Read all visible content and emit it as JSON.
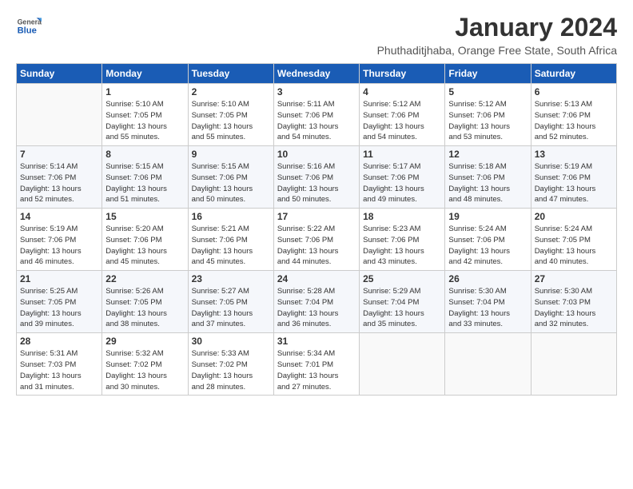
{
  "logo": {
    "general": "General",
    "blue": "Blue"
  },
  "title": "January 2024",
  "subtitle": "Phuthaditjhaba, Orange Free State, South Africa",
  "headers": [
    "Sunday",
    "Monday",
    "Tuesday",
    "Wednesday",
    "Thursday",
    "Friday",
    "Saturday"
  ],
  "weeks": [
    [
      {
        "num": "",
        "lines": []
      },
      {
        "num": "1",
        "lines": [
          "Sunrise: 5:10 AM",
          "Sunset: 7:05 PM",
          "Daylight: 13 hours",
          "and 55 minutes."
        ]
      },
      {
        "num": "2",
        "lines": [
          "Sunrise: 5:10 AM",
          "Sunset: 7:05 PM",
          "Daylight: 13 hours",
          "and 55 minutes."
        ]
      },
      {
        "num": "3",
        "lines": [
          "Sunrise: 5:11 AM",
          "Sunset: 7:06 PM",
          "Daylight: 13 hours",
          "and 54 minutes."
        ]
      },
      {
        "num": "4",
        "lines": [
          "Sunrise: 5:12 AM",
          "Sunset: 7:06 PM",
          "Daylight: 13 hours",
          "and 54 minutes."
        ]
      },
      {
        "num": "5",
        "lines": [
          "Sunrise: 5:12 AM",
          "Sunset: 7:06 PM",
          "Daylight: 13 hours",
          "and 53 minutes."
        ]
      },
      {
        "num": "6",
        "lines": [
          "Sunrise: 5:13 AM",
          "Sunset: 7:06 PM",
          "Daylight: 13 hours",
          "and 52 minutes."
        ]
      }
    ],
    [
      {
        "num": "7",
        "lines": [
          "Sunrise: 5:14 AM",
          "Sunset: 7:06 PM",
          "Daylight: 13 hours",
          "and 52 minutes."
        ]
      },
      {
        "num": "8",
        "lines": [
          "Sunrise: 5:15 AM",
          "Sunset: 7:06 PM",
          "Daylight: 13 hours",
          "and 51 minutes."
        ]
      },
      {
        "num": "9",
        "lines": [
          "Sunrise: 5:15 AM",
          "Sunset: 7:06 PM",
          "Daylight: 13 hours",
          "and 50 minutes."
        ]
      },
      {
        "num": "10",
        "lines": [
          "Sunrise: 5:16 AM",
          "Sunset: 7:06 PM",
          "Daylight: 13 hours",
          "and 50 minutes."
        ]
      },
      {
        "num": "11",
        "lines": [
          "Sunrise: 5:17 AM",
          "Sunset: 7:06 PM",
          "Daylight: 13 hours",
          "and 49 minutes."
        ]
      },
      {
        "num": "12",
        "lines": [
          "Sunrise: 5:18 AM",
          "Sunset: 7:06 PM",
          "Daylight: 13 hours",
          "and 48 minutes."
        ]
      },
      {
        "num": "13",
        "lines": [
          "Sunrise: 5:19 AM",
          "Sunset: 7:06 PM",
          "Daylight: 13 hours",
          "and 47 minutes."
        ]
      }
    ],
    [
      {
        "num": "14",
        "lines": [
          "Sunrise: 5:19 AM",
          "Sunset: 7:06 PM",
          "Daylight: 13 hours",
          "and 46 minutes."
        ]
      },
      {
        "num": "15",
        "lines": [
          "Sunrise: 5:20 AM",
          "Sunset: 7:06 PM",
          "Daylight: 13 hours",
          "and 45 minutes."
        ]
      },
      {
        "num": "16",
        "lines": [
          "Sunrise: 5:21 AM",
          "Sunset: 7:06 PM",
          "Daylight: 13 hours",
          "and 45 minutes."
        ]
      },
      {
        "num": "17",
        "lines": [
          "Sunrise: 5:22 AM",
          "Sunset: 7:06 PM",
          "Daylight: 13 hours",
          "and 44 minutes."
        ]
      },
      {
        "num": "18",
        "lines": [
          "Sunrise: 5:23 AM",
          "Sunset: 7:06 PM",
          "Daylight: 13 hours",
          "and 43 minutes."
        ]
      },
      {
        "num": "19",
        "lines": [
          "Sunrise: 5:24 AM",
          "Sunset: 7:06 PM",
          "Daylight: 13 hours",
          "and 42 minutes."
        ]
      },
      {
        "num": "20",
        "lines": [
          "Sunrise: 5:24 AM",
          "Sunset: 7:05 PM",
          "Daylight: 13 hours",
          "and 40 minutes."
        ]
      }
    ],
    [
      {
        "num": "21",
        "lines": [
          "Sunrise: 5:25 AM",
          "Sunset: 7:05 PM",
          "Daylight: 13 hours",
          "and 39 minutes."
        ]
      },
      {
        "num": "22",
        "lines": [
          "Sunrise: 5:26 AM",
          "Sunset: 7:05 PM",
          "Daylight: 13 hours",
          "and 38 minutes."
        ]
      },
      {
        "num": "23",
        "lines": [
          "Sunrise: 5:27 AM",
          "Sunset: 7:05 PM",
          "Daylight: 13 hours",
          "and 37 minutes."
        ]
      },
      {
        "num": "24",
        "lines": [
          "Sunrise: 5:28 AM",
          "Sunset: 7:04 PM",
          "Daylight: 13 hours",
          "and 36 minutes."
        ]
      },
      {
        "num": "25",
        "lines": [
          "Sunrise: 5:29 AM",
          "Sunset: 7:04 PM",
          "Daylight: 13 hours",
          "and 35 minutes."
        ]
      },
      {
        "num": "26",
        "lines": [
          "Sunrise: 5:30 AM",
          "Sunset: 7:04 PM",
          "Daylight: 13 hours",
          "and 33 minutes."
        ]
      },
      {
        "num": "27",
        "lines": [
          "Sunrise: 5:30 AM",
          "Sunset: 7:03 PM",
          "Daylight: 13 hours",
          "and 32 minutes."
        ]
      }
    ],
    [
      {
        "num": "28",
        "lines": [
          "Sunrise: 5:31 AM",
          "Sunset: 7:03 PM",
          "Daylight: 13 hours",
          "and 31 minutes."
        ]
      },
      {
        "num": "29",
        "lines": [
          "Sunrise: 5:32 AM",
          "Sunset: 7:02 PM",
          "Daylight: 13 hours",
          "and 30 minutes."
        ]
      },
      {
        "num": "30",
        "lines": [
          "Sunrise: 5:33 AM",
          "Sunset: 7:02 PM",
          "Daylight: 13 hours",
          "and 28 minutes."
        ]
      },
      {
        "num": "31",
        "lines": [
          "Sunrise: 5:34 AM",
          "Sunset: 7:01 PM",
          "Daylight: 13 hours",
          "and 27 minutes."
        ]
      },
      {
        "num": "",
        "lines": []
      },
      {
        "num": "",
        "lines": []
      },
      {
        "num": "",
        "lines": []
      }
    ]
  ]
}
